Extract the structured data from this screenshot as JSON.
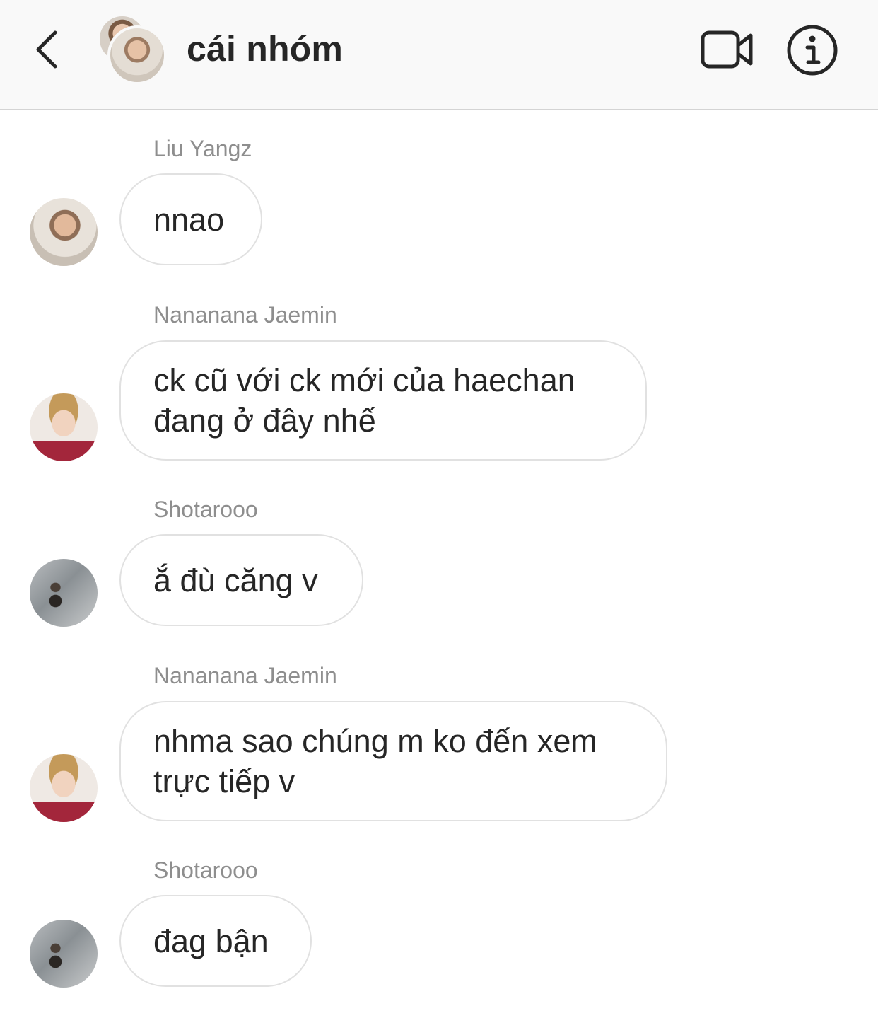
{
  "header": {
    "back_icon": "chevron-left-icon",
    "title": "cái nhóm",
    "video_icon": "video-camera-icon",
    "info_icon": "info-icon"
  },
  "messages": [
    {
      "sender": "Liu Yangz",
      "text": "nnao",
      "avatar": "hoodie-photo"
    },
    {
      "sender": "Nananana Jaemin",
      "text": "ck cũ với ck mới của haechan đang ở đây nhế",
      "avatar": "jaemin-photo"
    },
    {
      "sender": "Shotarooo",
      "text": "ắ đù căng v",
      "avatar": "shotaro-photo"
    },
    {
      "sender": "Nananana Jaemin",
      "text": "nhma sao chúng m ko đến xem trực tiếp v",
      "avatar": "jaemin-photo"
    },
    {
      "sender": "Shotarooo",
      "text": "đag bận",
      "avatar": "shotaro-photo"
    }
  ],
  "colors": {
    "header_bg": "#f9f9f9",
    "text": "#262626",
    "sender_name": "#8e8e8e",
    "bubble_border": "#e1e1e1"
  }
}
